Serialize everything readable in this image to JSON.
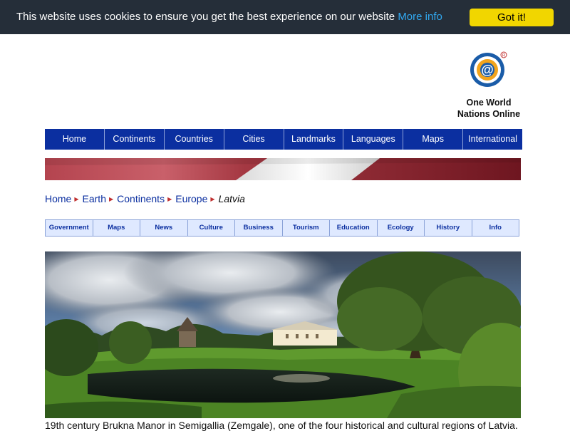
{
  "cookie": {
    "message": "This website uses cookies to ensure you get the best experience on our website",
    "more_info": "More info",
    "accept": "Got it!"
  },
  "logo": {
    "line1": "One World",
    "line2": "Nations Online",
    "icon": "at-globe-icon"
  },
  "main_nav": [
    "Home",
    "Continents",
    "Countries",
    "Cities",
    "Landmarks",
    "Languages",
    "Maps",
    "International"
  ],
  "banner": {
    "icon": "latvia-flag-banner",
    "colors": [
      "#9e3039",
      "#ffffff"
    ]
  },
  "breadcrumb": {
    "items": [
      "Home",
      "Earth",
      "Continents",
      "Europe"
    ],
    "current": "Latvia"
  },
  "sub_nav": [
    "Government",
    "Maps",
    "News",
    "Culture",
    "Business",
    "Tourism",
    "Education",
    "Ecology",
    "History",
    "Info"
  ],
  "hero": {
    "icon": "manor-landscape-photo"
  },
  "caption": "19th century Brukna Manor in Semigallia (Zemgale), one of the four historical and cultural regions of Latvia.",
  "colors": {
    "nav_bg": "#0b2fa0",
    "cookie_bg": "#252e39",
    "cookie_button": "#f1d600",
    "link": "#31a8f0"
  }
}
